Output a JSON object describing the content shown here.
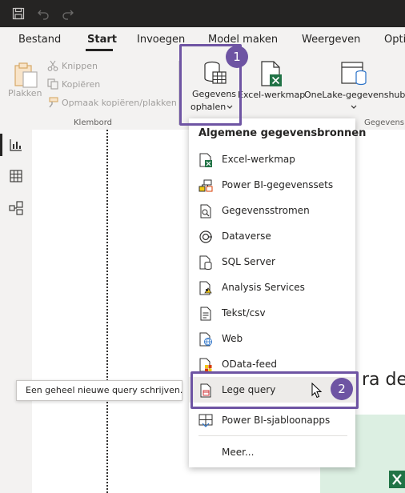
{
  "menu": {
    "tabs": [
      {
        "label": "Bestand"
      },
      {
        "label": "Start"
      },
      {
        "label": "Invoegen"
      },
      {
        "label": "Model maken"
      },
      {
        "label": "Weergeven"
      },
      {
        "label": "Opti"
      }
    ]
  },
  "ribbon": {
    "clipboard": {
      "paste": "Plakken",
      "cut": "Knippen",
      "copy": "Kopiëren",
      "format_painter": "Opmaak kopiëren/plakken",
      "group": "Klembord"
    },
    "data": {
      "get_data_line1": "Gegevens",
      "get_data_line2": "ophalen",
      "excel": "Excel-werkmap",
      "onelake": "OneLake-gegevenshub",
      "group": "Gegevens"
    }
  },
  "dropdown": {
    "title": "Algemene gegevensbronnen",
    "items": [
      {
        "label": "Excel-werkmap",
        "icon": "excel-icon"
      },
      {
        "label": "Power BI-gegevenssets",
        "icon": "dataset-icon"
      },
      {
        "label": "Gegevensstromen",
        "icon": "dataflow-icon"
      },
      {
        "label": "Dataverse",
        "icon": "dataverse-icon"
      },
      {
        "label": "SQL Server",
        "icon": "sql-server-icon"
      },
      {
        "label": "Analysis Services",
        "icon": "analysis-services-icon"
      },
      {
        "label": "Tekst/csv",
        "icon": "text-csv-icon"
      },
      {
        "label": "Web",
        "icon": "web-icon"
      },
      {
        "label": "OData-feed",
        "icon": "odata-icon"
      },
      {
        "label": "Lege query",
        "icon": "blank-query-icon"
      },
      {
        "label": "Power BI-sjabloonapps",
        "icon": "template-apps-icon"
      }
    ],
    "more": "Meer..."
  },
  "callouts": {
    "step1": "1",
    "step2": "2"
  },
  "tooltip": {
    "text": "Een geheel nieuwe query schrijven."
  },
  "canvas": {
    "partial_text": "ra de"
  },
  "colors": {
    "accent_purple": "#6e54a3",
    "excel_green": "#217346",
    "titlebar": "#252423",
    "ribbon_bg": "#f3f2f1"
  }
}
